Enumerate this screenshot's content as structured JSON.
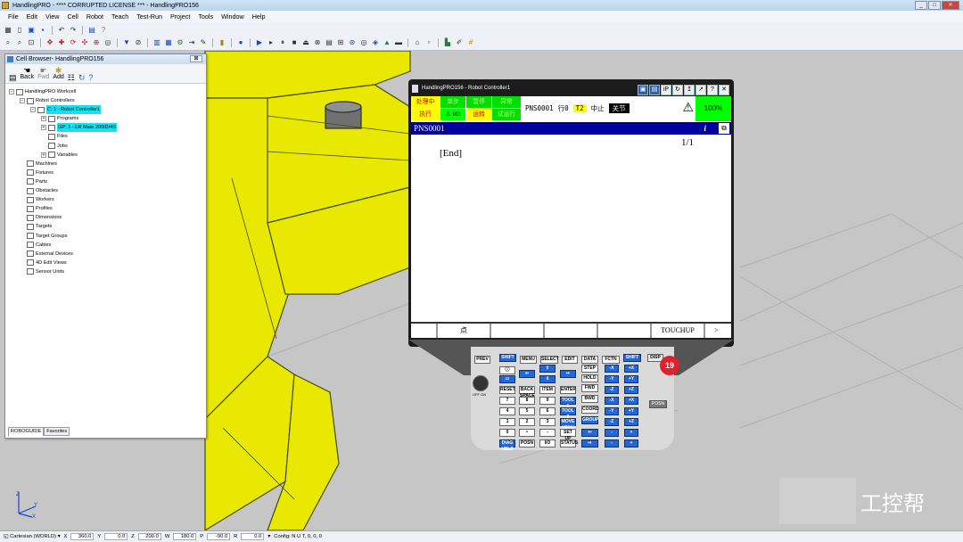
{
  "window": {
    "title": "HandlingPRO - **** CORRUPTED LICENSE *** - HandlingPRO156"
  },
  "menu": [
    "File",
    "Edit",
    "View",
    "Cell",
    "Robot",
    "Teach",
    "Test-Run",
    "Project",
    "Tools",
    "Window",
    "Help"
  ],
  "cell_browser": {
    "title": "Cell Browser- HandlingPRO156",
    "close_label": "⊠",
    "tools": {
      "back": "Back",
      "fwd": "Fwd",
      "add": "Add"
    },
    "tree": [
      {
        "label": "HandlingPRO Workcell",
        "level": 0,
        "icon": "workcell-icon"
      },
      {
        "label": "Robot Controllers",
        "level": 1,
        "icon": "controller-folder-icon"
      },
      {
        "label": "C: 1 - Robot Controller1",
        "level": 2,
        "icon": "controller-icon",
        "highlight": true
      },
      {
        "label": "Programs",
        "level": 3,
        "icon": "programs-icon"
      },
      {
        "label": "GP: 1 - LR Mate 200iD/4S",
        "level": 3,
        "icon": "robot-icon",
        "highlight": true
      },
      {
        "label": "Files",
        "level": 3,
        "icon": "files-icon"
      },
      {
        "label": "Jobs",
        "level": 3,
        "icon": "jobs-icon"
      },
      {
        "label": "Variables",
        "level": 3,
        "icon": "variables-icon"
      },
      {
        "label": "Machines",
        "level": 1,
        "icon": "machines-icon"
      },
      {
        "label": "Fixtures",
        "level": 1,
        "icon": "fixtures-icon"
      },
      {
        "label": "Parts",
        "level": 1,
        "icon": "parts-icon"
      },
      {
        "label": "Obstacles",
        "level": 1,
        "icon": "obstacles-icon"
      },
      {
        "label": "Workers",
        "level": 1,
        "icon": "workers-icon"
      },
      {
        "label": "Profiles",
        "level": 1,
        "icon": "profiles-icon"
      },
      {
        "label": "Dimensions",
        "level": 1,
        "icon": "dimensions-icon"
      },
      {
        "label": "Targets",
        "level": 1,
        "icon": "targets-icon"
      },
      {
        "label": "Target Groups",
        "level": 1,
        "icon": "target-groups-icon"
      },
      {
        "label": "Cables",
        "level": 1,
        "icon": "cables-icon"
      },
      {
        "label": "External Devices",
        "level": 1,
        "icon": "external-devices-icon"
      },
      {
        "label": "4D Edit Views",
        "level": 1,
        "icon": "edit-views-icon"
      },
      {
        "label": "Sensor Units",
        "level": 1,
        "icon": "sensor-units-icon"
      }
    ],
    "tabs": [
      "ROBOGUIDE",
      "Favorites"
    ]
  },
  "pendant": {
    "title": "HandlingPRO156 - Robot Controller1",
    "status": {
      "row1": [
        "处理中",
        "单步",
        "暂停",
        "异常"
      ],
      "row2": [
        "执行",
        "I/O",
        "运转",
        "试运行"
      ]
    },
    "program": "PNS0001",
    "line": "行0",
    "mode": "T2",
    "state": "中止",
    "coord": "关节",
    "speed": "100%",
    "header_program": "PNS0001",
    "info_icon": "i",
    "page": "1/1",
    "end_marker": "[End]",
    "fkeys": [
      "",
      "点",
      "",
      "",
      "",
      "TOUCHUP",
      ">"
    ],
    "badge": "19",
    "keys": {
      "prev": "PREV",
      "shift": "SHIFT",
      "menu": "MENU",
      "select": "SELECT",
      "edit": "EDIT",
      "data": "DATA",
      "fctn": "FCTN",
      "step": "STEP",
      "hold": "HOLD",
      "fwd": "FWD",
      "bwd": "BWD",
      "coord": "COORD",
      "group": "GROUP",
      "reset": "RESET",
      "enter": "ENTER",
      "item": "ITEM",
      "backspace": "BACK SPACE",
      "tool1": "TOOL 1",
      "tool2": "TOOL 2",
      "move_menu": "MOVE MENU",
      "setup": "SET UP",
      "posn": "POSN",
      "io": "I/O",
      "status": "STATUS",
      "disp": "DISP",
      "diag_help": "DIAG HELP",
      "offon": "OFF ON",
      "k7": "7",
      "k8": "8",
      "k9": "9",
      "k4": "4",
      "k5": "5",
      "k6": "6",
      "k1": "1",
      "k2": "2",
      "k3": "3",
      "k0": "0",
      "kdot": "•",
      "kminus": "-"
    }
  },
  "statusbar": {
    "frame": "Cartesian (WORLD)",
    "x_label": "X",
    "x": "360.0",
    "y_label": "Y",
    "y": "0.0",
    "z_label": "Z",
    "z": "200.0",
    "w_label": "W",
    "w": "180.0",
    "p_label": "P",
    "p": "-90.0",
    "r_label": "R",
    "r": "0.0",
    "config": "Config: N U T, 0, 0, 0"
  },
  "watermark": "工控帮",
  "colors": {
    "robot": "#e8e800",
    "floor": "#c6c6c6",
    "highlight": "#18e0f0",
    "pendant_blue": "#0000a0"
  }
}
